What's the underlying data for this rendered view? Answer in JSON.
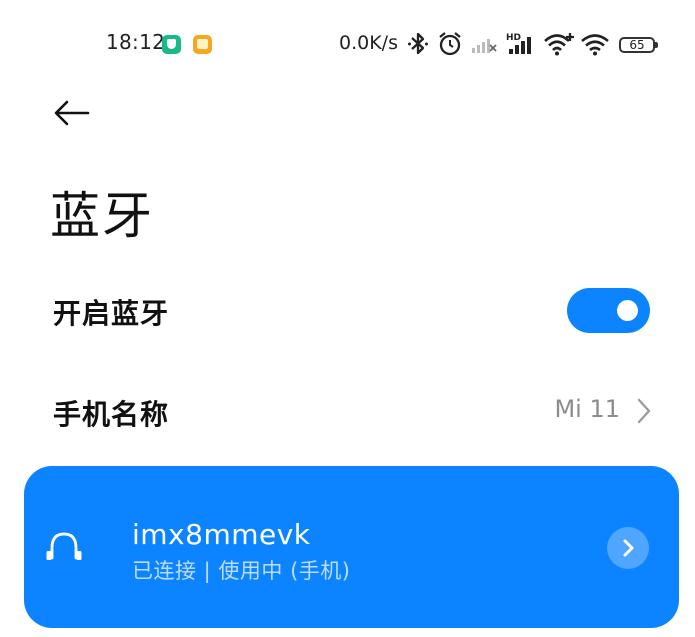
{
  "status_bar": {
    "time": "18:12",
    "network_speed": "0.0K/s",
    "battery_level": "65",
    "icons": [
      "shield-app-icon",
      "notes-app-icon",
      "bluetooth-icon",
      "alarm-icon",
      "mobile-signal-off-icon",
      "hd-signal-icon",
      "wifi-plus-icon",
      "wifi-icon",
      "battery-icon"
    ],
    "colors": {
      "shield_app": "#19b98a",
      "notes_app": "#f5a623"
    }
  },
  "header": {
    "back_icon": "arrow-left-icon",
    "title": "蓝牙"
  },
  "settings": {
    "bluetooth_toggle": {
      "label": "开启蓝牙",
      "enabled": true
    },
    "device_name": {
      "label": "手机名称",
      "value": "Mi 11"
    }
  },
  "paired_device": {
    "icon": "headset-icon",
    "name": "imx8mmevk",
    "status": "已连接 | 使用中 (手机)",
    "action_icon": "chevron-right-icon"
  },
  "colors": {
    "accent": "#0d84ff",
    "text_primary": "#111111",
    "text_secondary": "#8c8c8c",
    "background": "#ffffff"
  }
}
